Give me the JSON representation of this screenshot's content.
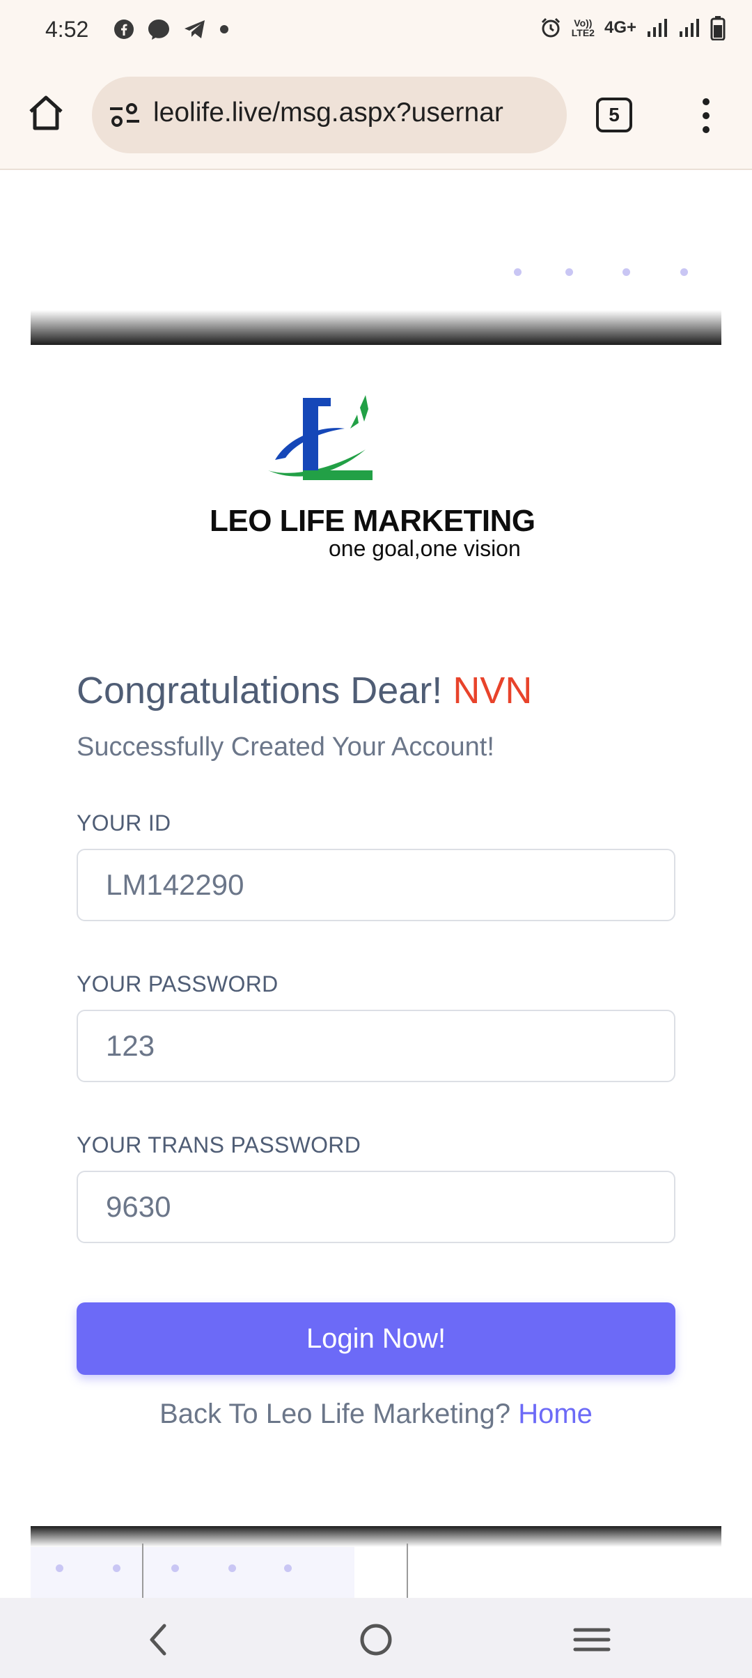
{
  "status_bar": {
    "time": "4:52",
    "network_label": "4G+",
    "volte_line1": "Vo))",
    "volte_line2": "LTE2",
    "left_icons": [
      "facebook-icon",
      "messenger-icon",
      "telegram-icon",
      "notification-dot-icon"
    ],
    "right_icons": [
      "alarm-icon",
      "volte-icon",
      "signal-icon",
      "signal-icon",
      "battery-icon"
    ]
  },
  "browser": {
    "url": "leolife.live/msg.aspx?usernar",
    "tab_count": "5"
  },
  "brand": {
    "name": "LEO LIFE MARKETING",
    "tagline": "one goal,one vision",
    "logo_colors": {
      "blue": "#1547b8",
      "green": "#22a046"
    }
  },
  "greeting": {
    "prefix": "Congratulations Dear!",
    "name": "NVN",
    "subtitle": "Successfully Created Your Account!"
  },
  "fields": [
    {
      "label": "YOUR ID",
      "value": "LM142290"
    },
    {
      "label": "YOUR PASSWORD",
      "value": "123"
    },
    {
      "label": "YOUR TRANS PASSWORD",
      "value": "9630"
    }
  ],
  "login_button": {
    "label": "Login Now!"
  },
  "back_link": {
    "text": "Back To Leo Life Marketing?",
    "link_label": "Home"
  },
  "colors": {
    "accent": "#6c6af7",
    "name_highlight": "#e8432b",
    "heading": "#4f5d75"
  }
}
